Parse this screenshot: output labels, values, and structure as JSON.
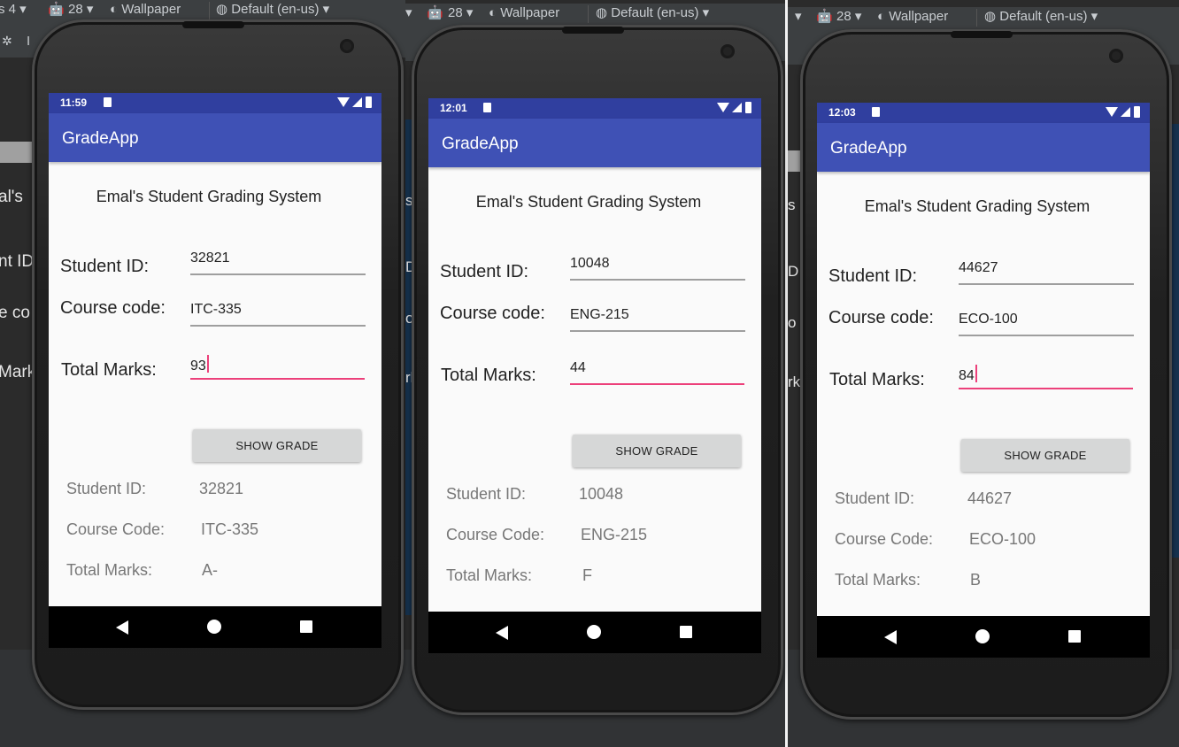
{
  "ide": {
    "api_prefix": "s 4",
    "api_level": "28",
    "wallpaper_label": "Wallpaper",
    "locale_label": "Default (en-us)",
    "ghost_texts_left": [
      "al's",
      "nt ID",
      "e co",
      "Mark"
    ],
    "ghost_texts_mid": [
      "s",
      "D",
      "o",
      "rk"
    ],
    "ghost_texts_right": [
      "s",
      "D",
      "o",
      "rk"
    ]
  },
  "app": {
    "title": "GradeApp",
    "heading": "Emal's Student Grading System",
    "labels": {
      "student_id": "Student ID:",
      "course_code": "Course code:",
      "total_marks": "Total Marks:"
    },
    "button_label": "SHOW GRADE",
    "result_labels": {
      "student_id": "Student ID:",
      "course_code": "Course Code:",
      "total_marks": "Total Marks:"
    }
  },
  "phones": [
    {
      "time": "11:59",
      "inputs": {
        "student_id": "32821",
        "course_code": "ITC-335",
        "total_marks": "93"
      },
      "results": {
        "student_id": "32821",
        "course_code": "ITC-335",
        "grade": "A-"
      }
    },
    {
      "time": "12:01",
      "inputs": {
        "student_id": "10048",
        "course_code": "ENG-215",
        "total_marks": "44"
      },
      "results": {
        "student_id": "10048",
        "course_code": "ENG-215",
        "grade": "F"
      }
    },
    {
      "time": "12:03",
      "inputs": {
        "student_id": "44627",
        "course_code": "ECO-100",
        "total_marks": "84"
      },
      "results": {
        "student_id": "44627",
        "course_code": "ECO-100",
        "grade": "B"
      }
    }
  ],
  "colors": {
    "status_bar": "#303f9f",
    "app_bar": "#3f51b5",
    "focus_underline": "#ec407a",
    "button": "#d6d7d7"
  }
}
